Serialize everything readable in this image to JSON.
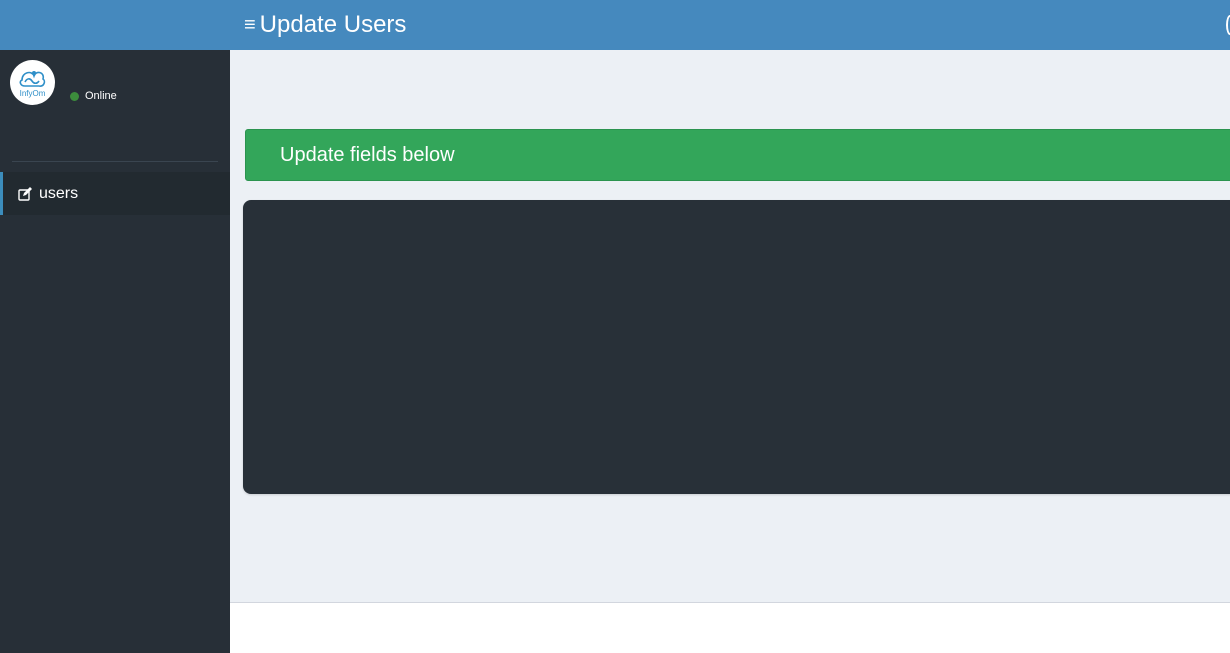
{
  "header": {
    "menu_toggle": "≡",
    "title": "Update Users"
  },
  "sidebar": {
    "logo_text": "InfyOm",
    "status": "Online",
    "items": [
      {
        "label": "users",
        "icon": "edit-icon",
        "active": true
      }
    ]
  },
  "main": {
    "alert_text": "Update fields below"
  },
  "colors": {
    "header_blue": "#4589be",
    "sidebar_dark": "#272f37",
    "alert_green": "#33a65a",
    "panel_dark": "#283038",
    "content_bg": "#ecf0f5",
    "status_green": "#3c8d3c"
  }
}
